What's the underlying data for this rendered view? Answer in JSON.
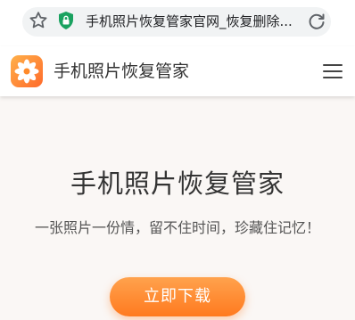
{
  "browser": {
    "url_display": "手机照片恢复管家官网_恢复删除..."
  },
  "header": {
    "site_title": "手机照片恢复管家"
  },
  "hero": {
    "title": "手机照片恢复管家",
    "subtitle": "一张照片一份情，留不住时间，珍藏住记忆！",
    "download_label": "立即下载"
  },
  "icons": {
    "bookmark": "star-icon",
    "security": "shield-lock-icon",
    "reload": "reload-icon",
    "logo": "flower-logo-icon",
    "menu": "hamburger-menu-icon"
  },
  "colors": {
    "accent_orange": "#ff8a2a",
    "shield_green": "#1aa260",
    "hero_background": "#faf7f5"
  }
}
